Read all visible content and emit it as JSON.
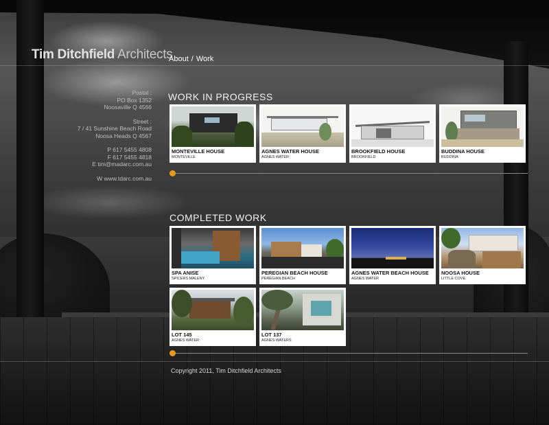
{
  "site": {
    "logo_name": "Tim Ditchfield",
    "logo_suffix": " Architects"
  },
  "nav": {
    "about": "About",
    "separator": "/",
    "work": "Work"
  },
  "contact": {
    "postal_label": "Postal :",
    "postal_line1": "PO Box 1352",
    "postal_line2": "Noosaville Q 4566",
    "street_label": "Street :",
    "street_line1": "7 / 41 Sunshine Beach Road",
    "street_line2": "Noosa Heads Q 4567",
    "phone": "P 617 5455 4808",
    "fax": "F 617 5455 4818",
    "email": "E tim@madarc.com.au",
    "web": "W www.tdarc.com.au"
  },
  "work_in_progress": {
    "heading": "WORK IN PROGRESS",
    "slider_position": 0,
    "items": [
      {
        "title": "MONTEVILLE HOUSE",
        "location": "MONTEVILLE"
      },
      {
        "title": "AGNES WATER HOUSE",
        "location": "AGNES WATER"
      },
      {
        "title": "BROOKFIELD HOUSE",
        "location": "BROOKFIELD"
      },
      {
        "title": "BUDDINA HOUSE",
        "location": "BUDDINA"
      }
    ]
  },
  "completed_work": {
    "heading": "COMPLETED WORK",
    "slider_position": 0,
    "items": [
      {
        "title": "SPA ANISE",
        "location": "SPICERS MALENY"
      },
      {
        "title": "PEREGIAN BEACH HOUSE",
        "location": "PEREGIAN BEACH"
      },
      {
        "title": "AGNES WATER BEACH HOUSE",
        "location": "AGNES WATER"
      },
      {
        "title": "NOOSA HOUSE",
        "location": "LITTLE COVE"
      },
      {
        "title": "LOT 145",
        "location": "AGNES WATER"
      },
      {
        "title": "LOT 137",
        "location": "AGNES WATERS"
      }
    ]
  },
  "footer": {
    "copyright": "Copyright 2011, Tim Ditchfield Architects"
  },
  "colors": {
    "accent": "#e69a1a",
    "card_bg": "#ffffff"
  }
}
